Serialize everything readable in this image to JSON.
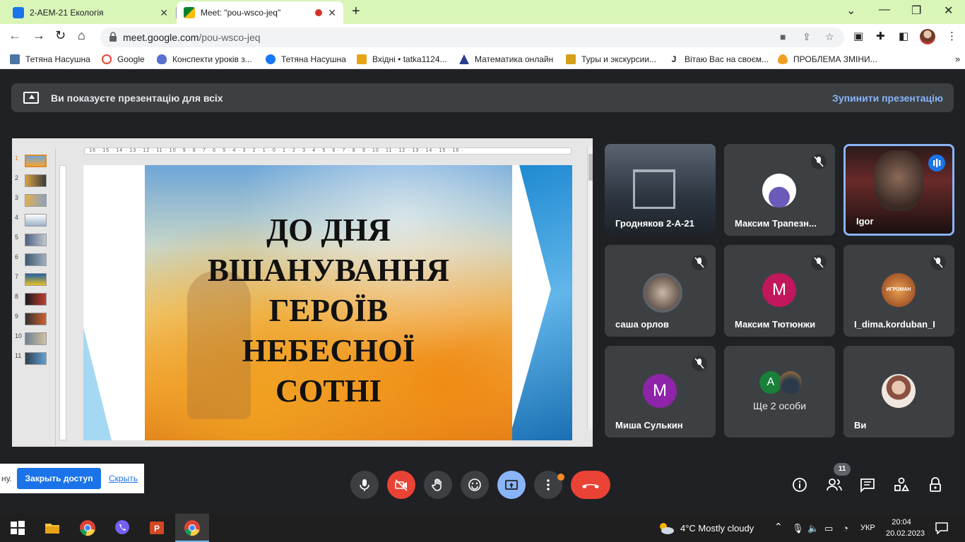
{
  "browser": {
    "tabs": [
      {
        "title": "2-АЕМ-21 Екологія",
        "favicon": "classroom-icon",
        "color": "#1a73e8",
        "active": false
      },
      {
        "title": "Meet: \"pou-wsco-jeq\"",
        "favicon": "meet-icon",
        "color": "#00832d",
        "active": true
      }
    ],
    "url_domain": "meet.google.com",
    "url_path": "/pou-wsco-jeq",
    "bookmarks": [
      {
        "label": "Тетяна Насушна",
        "icon": "vk-icon",
        "color": "#4c75a3"
      },
      {
        "label": "Google",
        "icon": "google-icon",
        "color": "#ea4335"
      },
      {
        "label": "Конспекти уроків з...",
        "icon": "shield-icon",
        "color": "#5a6fd0"
      },
      {
        "label": "Тетяна Насушна",
        "icon": "facebook-icon",
        "color": "#1877f2"
      },
      {
        "label": "Вхідні • tatka1124...",
        "icon": "mail-icon",
        "color": "#e8a317"
      },
      {
        "label": "Математика онлайн",
        "icon": "triangle-icon",
        "color": "#2a3d8f"
      },
      {
        "label": "Туры и экскурсии...",
        "icon": "tour-icon",
        "color": "#d4a017"
      },
      {
        "label": "Вітаю Вас на своєм...",
        "icon": "j-icon",
        "color": "#222222"
      },
      {
        "label": "ПРОБЛЕМА ЗМІНИ...",
        "icon": "flame-icon",
        "color": "#f0a020"
      }
    ]
  },
  "meet": {
    "banner_text": "Ви показуєте презентацію для всіх",
    "stop_label": "Зупинити презентацію",
    "slide": {
      "title_lines": [
        "ДО ДНЯ",
        "ВШАНУВАННЯ",
        "ГЕРОЇВ",
        "НЕБЕСНОЇ",
        "СОТНІ"
      ],
      "thumb_numbers": [
        "1",
        "2",
        "3",
        "4",
        "5",
        "6",
        "7",
        "8",
        "9",
        "10",
        "11"
      ],
      "ruler": "· 16 · 15 · 14 · 13 · 12 · 11 · 10 · 9 · 8 · 7 · 6 · 5 · 4 · 3 · 2 · 1 · 0 · 1 · 2 · 3 · 4 · 5 · 6 · 7 · 8 · 9 · 10 · 11 · 12 · 13 · 14 · 15 · 16 ·"
    },
    "participants": [
      {
        "name": "Гродняков 2-А-21",
        "muted": false
      },
      {
        "name": "Максим Трапезн...",
        "muted": true
      },
      {
        "name": "Igor",
        "muted": false,
        "speaking": true
      },
      {
        "name": "саша орлов",
        "muted": true
      },
      {
        "name": "Максим Тютюнжи",
        "muted": true,
        "initial": "М",
        "avatar_color": "#c2185b"
      },
      {
        "name": "I_dima.korduban_I",
        "muted": true
      },
      {
        "name": "Миша Сулькин",
        "muted": true,
        "initial": "М",
        "avatar_color": "#8e24aa"
      },
      {
        "name": "Ще 2 особи",
        "muted": false,
        "initial": "A",
        "avatar_color": "#188038"
      },
      {
        "name": "Ви",
        "muted": false
      }
    ],
    "avatar_logo_text": "ИГРОМАН",
    "popup": {
      "text": "ну.",
      "share_button": "Закрыть доступ",
      "hide_link": "Скрыть"
    },
    "participant_count": "11"
  },
  "taskbar": {
    "weather": "4°C  Mostly cloudy",
    "language": "УКР",
    "time": "20:04",
    "date": "20.02.2023"
  },
  "colors": {
    "accent": "#8ab4f8",
    "danger": "#ea4335",
    "tabstrip": "#d9f5b8",
    "tile": "#3c4043"
  }
}
